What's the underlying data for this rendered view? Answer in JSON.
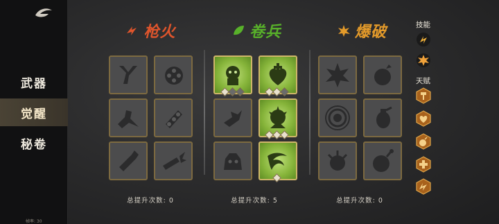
{
  "sidebar": {
    "items": [
      {
        "label": "武器",
        "active": false
      },
      {
        "label": "觉醒",
        "active": true
      },
      {
        "label": "秘卷",
        "active": false
      }
    ],
    "footer": "帧率: 30"
  },
  "columns": [
    {
      "title": "枪火",
      "color": "#e0552c",
      "count_label": "总提升次数: 0"
    },
    {
      "title": "卷兵",
      "color": "#58b12a",
      "count_label": "总提升次数: 5"
    },
    {
      "title": "爆破",
      "color": "#e39a2a",
      "count_label": "总提升次数: 0"
    }
  ],
  "right_panel": {
    "skills_label": "技能",
    "talent_label": "天赋"
  },
  "colors": {
    "accent_gold": "#c89a4a",
    "active_green": "#86b43a"
  }
}
